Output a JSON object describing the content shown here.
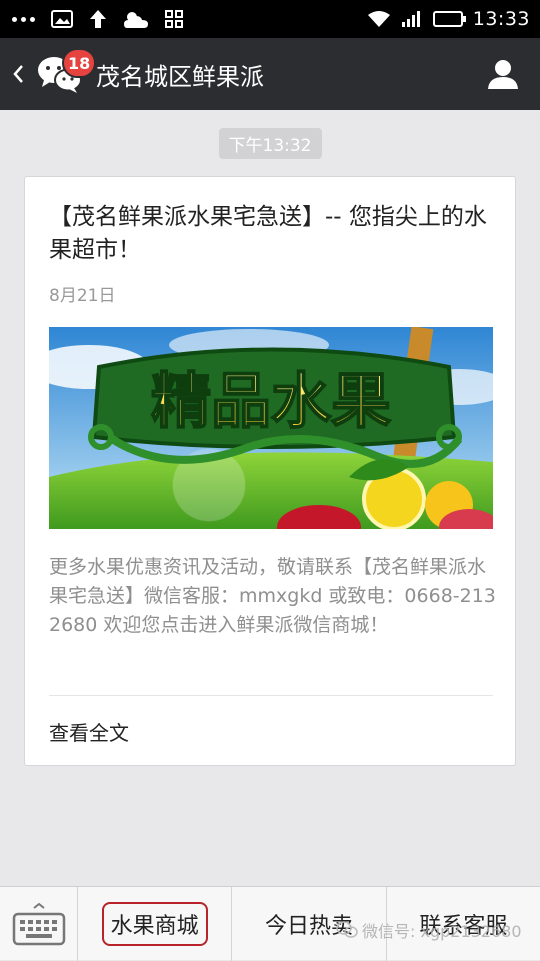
{
  "status_bar": {
    "time": "13:33",
    "icons": [
      "more-dots-icon",
      "image-icon",
      "upload-arrow-icon",
      "weather-cloud-icon",
      "grid-icon",
      "wifi-icon",
      "signal-icon",
      "battery-icon"
    ]
  },
  "header": {
    "back_icon": "chevron-left-icon",
    "unread_badge": "18",
    "title": "茂名城区鲜果派",
    "profile_icon": "person-icon",
    "background": "#2c2d30"
  },
  "chat": {
    "timestamp": "下午13:32",
    "article": {
      "title": "【茂名鲜果派水果宅急送】-- 您指尖上的水果超市！",
      "date": "8月21日",
      "image_text": "精品水果",
      "description": "更多水果优惠资讯及活动，敬请联系【茂名鲜果派水果宅急送】微信客服：mmxgkd  或致电：0668-2132680  欢迎您点击进入鲜果派微信商城！",
      "read_more": "查看全文"
    }
  },
  "bottom_menu": {
    "keyboard_icon": "keyboard-icon",
    "items": [
      {
        "label": "水果商城"
      },
      {
        "label": "今日热卖"
      },
      {
        "label": "联系客服"
      }
    ],
    "highlight_color": "#b8232a"
  },
  "watermark": "微信号: xgp2132680"
}
